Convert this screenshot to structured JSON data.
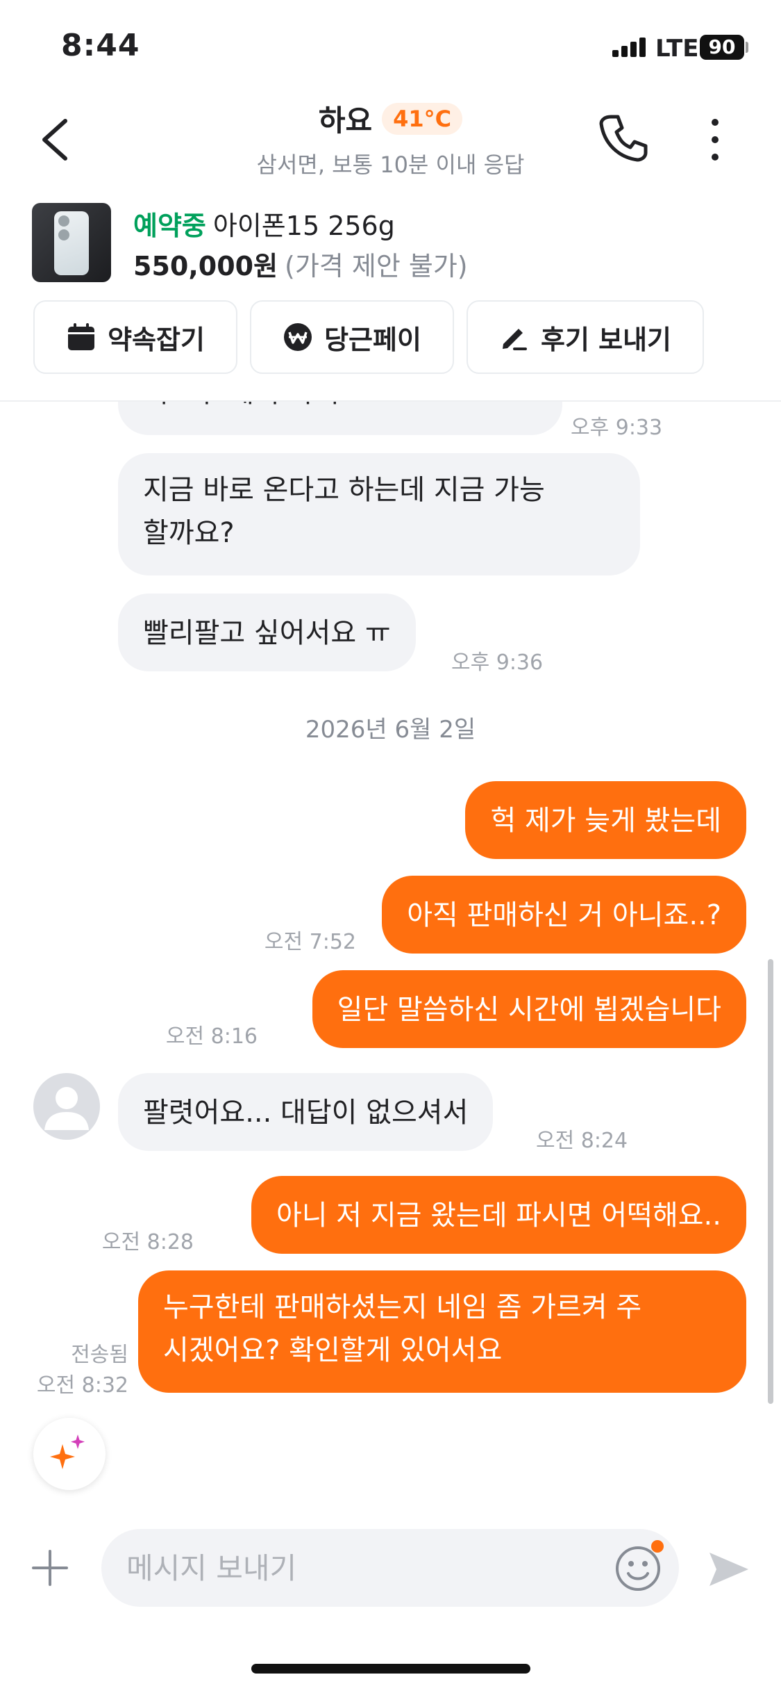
{
  "status_bar": {
    "time": "8:44",
    "network": "LTE",
    "battery": "90"
  },
  "header": {
    "title": "하요",
    "temperature": "41°C",
    "subtitle": "삼서면, 보통 10분 이내 응답"
  },
  "product": {
    "status": "예약중",
    "name": "아이폰15 256g",
    "price": "550,000원",
    "price_note": "(가격 제안 불가)"
  },
  "actions": [
    {
      "label": "약속잡기",
      "icon": "calendar-icon"
    },
    {
      "label": "당근페이",
      "icon": "won-icon"
    },
    {
      "label": "후기 보내기",
      "icon": "pencil-icon"
    }
  ],
  "messages": {
    "m0": {
      "text": "어보구 계서 타기...",
      "time": "오후 9:33"
    },
    "m1": {
      "line1": "지금 바로 온다고 하는데 지금 가능",
      "line2": "할까요?"
    },
    "m2": {
      "text": "빨리팔고 싶어서요 ㅠ",
      "time": "오후 9:36"
    },
    "date": "2026년 6월 2일",
    "m3": {
      "text": "헉 제가 늦게 봤는데"
    },
    "m4": {
      "text": "아직 판매하신 거 아니죠..?",
      "time": "오전 7:52"
    },
    "m5": {
      "text": "일단 말씀하신 시간에 뵙겠습니다",
      "time": "오전 8:16"
    },
    "m6": {
      "text": "팔렷어요... 대답이 없으셔서",
      "time": "오전 8:24"
    },
    "m7": {
      "text": "아니 저 지금 왔는데 파시면 어떡해요..",
      "time": "오전 8:28"
    },
    "m8": {
      "line1": "누구한테 판매하셨는지 네임 좀 가르켜 주",
      "line2": "시겠어요? 확인할게 있어서요",
      "status": "전송됨",
      "time": "오전 8:32"
    }
  },
  "input": {
    "placeholder": "메시지 보내기"
  },
  "colors": {
    "accent": "#ff6f0f",
    "reserve": "#00a05b",
    "bubble_in": "#f2f3f6"
  }
}
